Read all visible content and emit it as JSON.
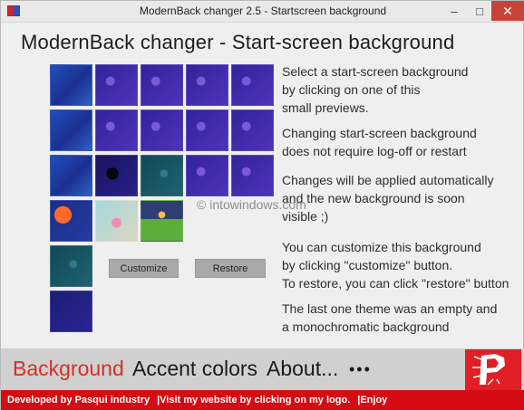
{
  "window": {
    "title": "ModernBack changer 2.5 - Startscreen background",
    "minimize_glyph": "–",
    "maximize_glyph": "□",
    "close_glyph": "✕"
  },
  "main": {
    "heading": "ModernBack changer - Start-screen background",
    "paragraphs": [
      "Select a start-screen background\nby clicking on one of this\nsmall previews.",
      "Changing start-screen background\ndoes not require log-off or restart",
      "Changes will be applied automatically\nand the new background is soon\nvisible ;)",
      "You can customize this background\nby clicking \"customize\" button.\nTo restore, you can click \"restore\" button",
      "The last one theme was an empty and\na monochromatic background"
    ],
    "buttons": {
      "customize": "Customize",
      "restore": "Restore"
    },
    "watermark": "© intowindows.com"
  },
  "nav": {
    "items": [
      "Background",
      "Accent colors",
      "About..."
    ],
    "more": "•••"
  },
  "footer": {
    "parts": [
      "Developed by Pasqui industry",
      "Visit my website by clicking on my logo.",
      "Enjoy"
    ],
    "separator": "|"
  },
  "colors": {
    "accent_red": "#d62f2a",
    "footer_red": "#d60c14",
    "logo_red": "#e11f26",
    "tile_dark_blue": "#1f2f88",
    "tile_purple": "#3f2ca0",
    "tile_teal": "#1f5c6b"
  },
  "tiles": [
    {
      "row": 0,
      "col": 0,
      "type": "blue"
    },
    {
      "row": 0,
      "col": 1,
      "type": "purple"
    },
    {
      "row": 0,
      "col": 2,
      "type": "purple"
    },
    {
      "row": 0,
      "col": 3,
      "type": "purple"
    },
    {
      "row": 0,
      "col": 4,
      "type": "purple"
    },
    {
      "row": 1,
      "col": 0,
      "type": "blue"
    },
    {
      "row": 1,
      "col": 1,
      "type": "purple"
    },
    {
      "row": 1,
      "col": 2,
      "type": "purple"
    },
    {
      "row": 1,
      "col": 3,
      "type": "purple"
    },
    {
      "row": 1,
      "col": 4,
      "type": "purple"
    },
    {
      "row": 2,
      "col": 0,
      "type": "blue"
    },
    {
      "row": 2,
      "col": 1,
      "type": "dark"
    },
    {
      "row": 2,
      "col": 2,
      "type": "teal"
    },
    {
      "row": 2,
      "col": 3,
      "type": "purple"
    },
    {
      "row": 2,
      "col": 4,
      "type": "purple"
    },
    {
      "row": 3,
      "col": 0,
      "type": "orange"
    },
    {
      "row": 3,
      "col": 1,
      "type": "light"
    },
    {
      "row": 3,
      "col": 2,
      "type": "green"
    },
    {
      "row": 4,
      "col": 0,
      "type": "teal"
    },
    {
      "row": 5,
      "col": 0,
      "type": "navy"
    }
  ]
}
